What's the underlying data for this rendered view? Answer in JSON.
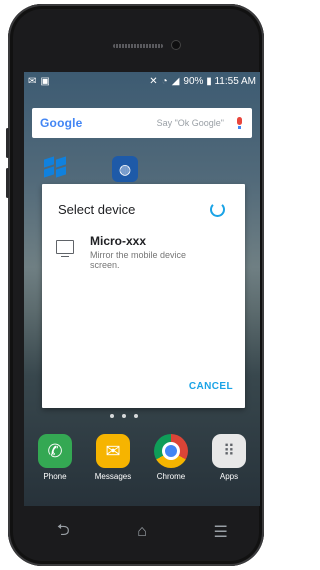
{
  "status_bar": {
    "left_icons": [
      "mail-icon",
      "image-icon"
    ],
    "right_text": "90% ▮ 11:55 AM"
  },
  "google_search": {
    "logo": "Google",
    "hint": "Say \"Ok Google\""
  },
  "dialog": {
    "title": "Select device",
    "device_name": "Micro-xxx",
    "device_desc": "Mirror the mobile device screen.",
    "cancel_label": "CANCEL"
  },
  "dock": {
    "apps": [
      {
        "label": "Phone",
        "color": "#34a853"
      },
      {
        "label": "Messages",
        "color": "#f6b400"
      },
      {
        "label": "Chrome",
        "color": "#db4437"
      },
      {
        "label": "Apps",
        "color": "#e8e8e8"
      }
    ]
  },
  "nav_bar": {
    "back": "⮌",
    "home": "⌂",
    "recents": "☰"
  }
}
